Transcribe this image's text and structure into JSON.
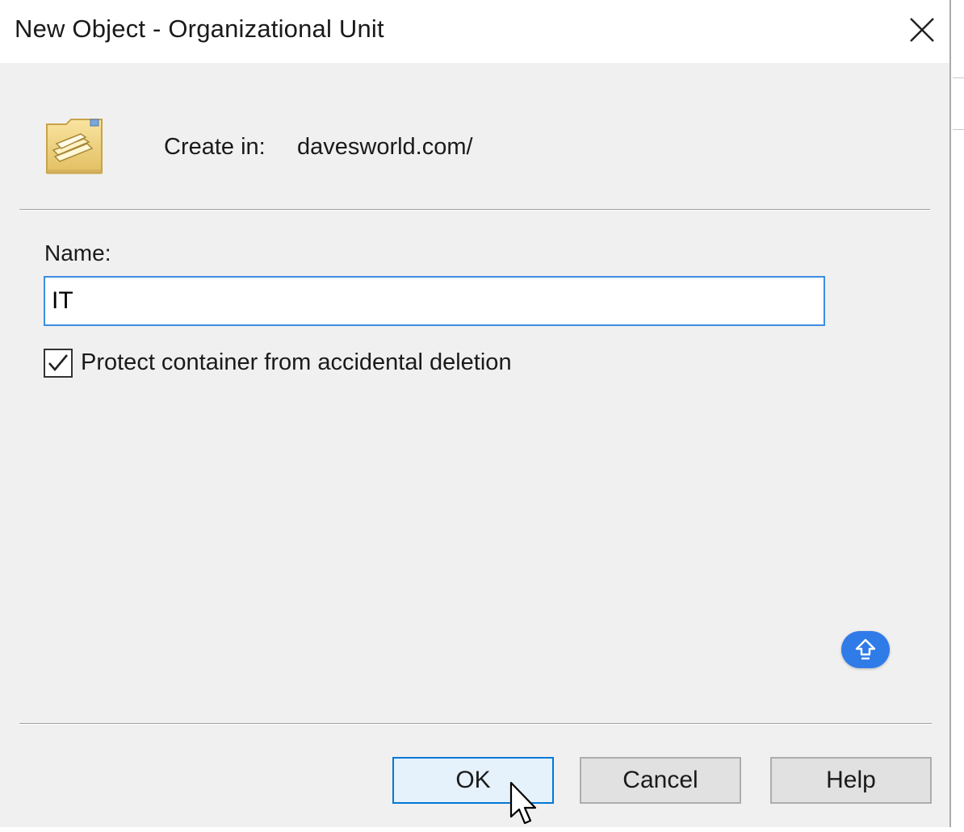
{
  "window": {
    "title": "New Object - Organizational Unit",
    "close_icon": "close-icon"
  },
  "header": {
    "icon": "organizational-unit-folder-icon",
    "create_in_label": "Create in:",
    "create_in_value": "davesworld.com/"
  },
  "form": {
    "name_label": "Name:",
    "name_value": "IT",
    "protect_checkbox_label": "Protect container from accidental deletion",
    "protect_checked": true
  },
  "overlay": {
    "floating_button_icon": "arrow-up-icon",
    "floating_button_color": "#2f7be8"
  },
  "buttons": {
    "ok": "OK",
    "cancel": "Cancel",
    "help": "Help"
  },
  "colors": {
    "dialog_bg": "#f0f0f0",
    "input_focus_border": "#3c8ee0",
    "default_button_border": "#0078d7"
  }
}
